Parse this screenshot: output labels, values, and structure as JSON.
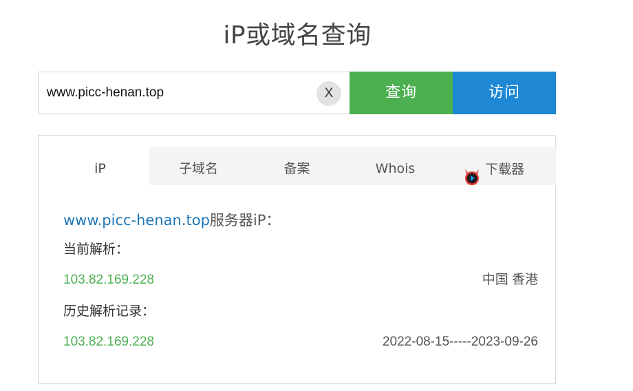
{
  "page": {
    "title": "iP或域名查询"
  },
  "search": {
    "value": "www.picc-henan.top",
    "clear_label": "X",
    "query_label": "查询",
    "visit_label": "访问"
  },
  "tabs": [
    {
      "label": "iP",
      "active": true
    },
    {
      "label": "子域名"
    },
    {
      "label": "备案"
    },
    {
      "label": "Whois"
    },
    {
      "label": "下载器",
      "icon": "devil-play-icon"
    }
  ],
  "result": {
    "domain": "www.picc-henan.top",
    "server_suffix": "服务器iP：",
    "current_label": "当前解析：",
    "current": {
      "ip": "103.82.169.228",
      "location": "中国 香港"
    },
    "history_label": "历史解析记录：",
    "history": [
      {
        "ip": "103.82.169.228",
        "range": "2022-08-15-----2023-09-26"
      }
    ]
  },
  "colors": {
    "query_button": "#4caf50",
    "visit_button": "#1e88d4",
    "ip_green": "#4caf50",
    "link_blue": "#1d76b8"
  }
}
